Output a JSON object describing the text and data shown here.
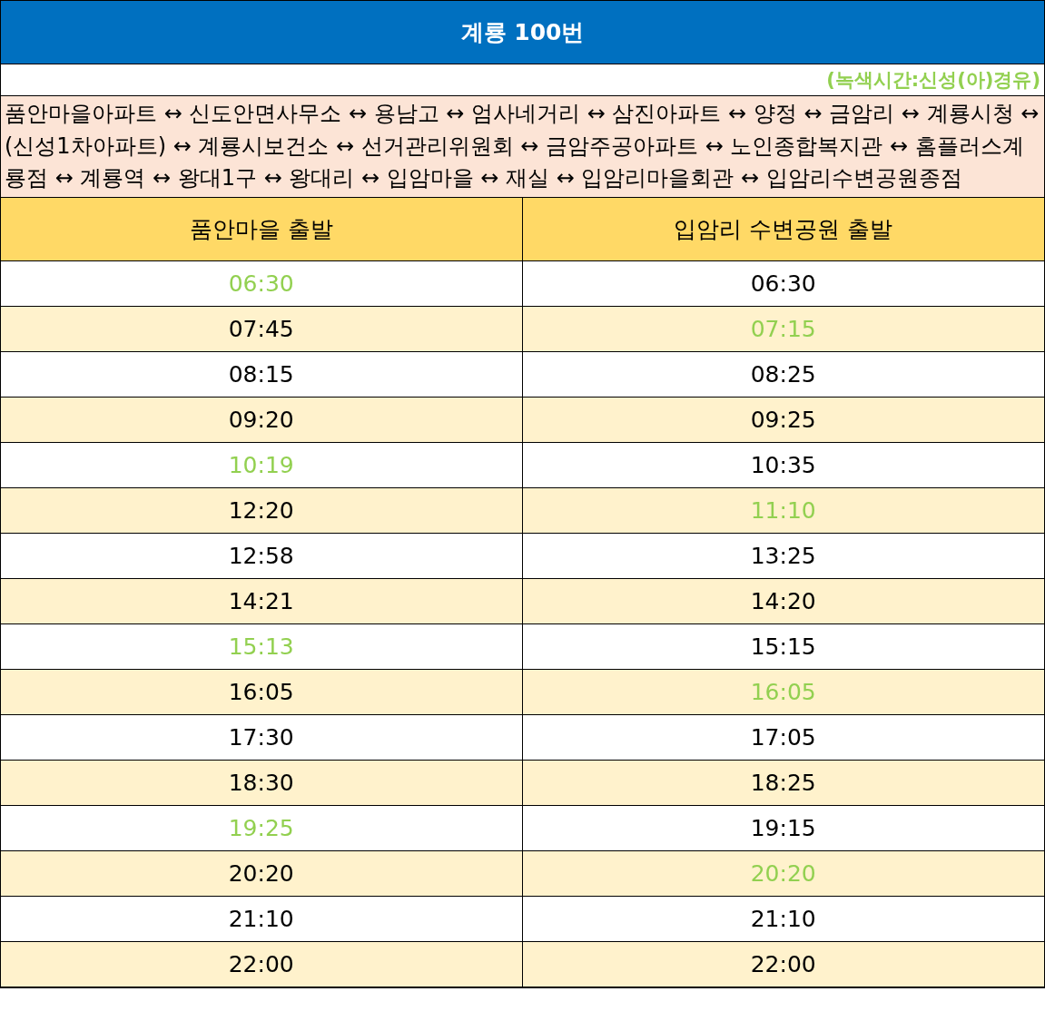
{
  "title": "계룡 100번",
  "note": "(녹색시간:신성(아)경유)",
  "route": "품안마을아파트 ↔ 신도안면사무소 ↔ 용남고 ↔ 엄사네거리 ↔ 삼진아파트 ↔ 양정 ↔ 금암리 ↔ 계룡시청 ↔ (신성1차아파트) ↔ 계룡시보건소 ↔ 선거관리위원회 ↔ 금암주공아파트 ↔ 노인종합복지관 ↔ 홈플러스계룡점 ↔ 계룡역 ↔ 왕대1구 ↔ 왕대리 ↔ 입암마을 ↔ 재실 ↔ 입암리마을회관 ↔ 입암리수변공원종점",
  "columns": [
    "품안마을 출발",
    "입암리 수변공원 출발"
  ],
  "rows": [
    {
      "cells": [
        {
          "time": "06:30",
          "highlighted": true
        },
        {
          "time": "06:30",
          "highlighted": false
        }
      ]
    },
    {
      "cells": [
        {
          "time": "07:45",
          "highlighted": false
        },
        {
          "time": "07:15",
          "highlighted": true
        }
      ]
    },
    {
      "cells": [
        {
          "time": "08:15",
          "highlighted": false
        },
        {
          "time": "08:25",
          "highlighted": false
        }
      ]
    },
    {
      "cells": [
        {
          "time": "09:20",
          "highlighted": false
        },
        {
          "time": "09:25",
          "highlighted": false
        }
      ]
    },
    {
      "cells": [
        {
          "time": "10:19",
          "highlighted": true
        },
        {
          "time": "10:35",
          "highlighted": false
        }
      ]
    },
    {
      "cells": [
        {
          "time": "12:20",
          "highlighted": false
        },
        {
          "time": "11:10",
          "highlighted": true
        }
      ]
    },
    {
      "cells": [
        {
          "time": "12:58",
          "highlighted": false
        },
        {
          "time": "13:25",
          "highlighted": false
        }
      ]
    },
    {
      "cells": [
        {
          "time": "14:21",
          "highlighted": false
        },
        {
          "time": "14:20",
          "highlighted": false
        }
      ]
    },
    {
      "cells": [
        {
          "time": "15:13",
          "highlighted": true
        },
        {
          "time": "15:15",
          "highlighted": false
        }
      ]
    },
    {
      "cells": [
        {
          "time": "16:05",
          "highlighted": false
        },
        {
          "time": "16:05",
          "highlighted": true
        }
      ]
    },
    {
      "cells": [
        {
          "time": "17:30",
          "highlighted": false
        },
        {
          "time": "17:05",
          "highlighted": false
        }
      ]
    },
    {
      "cells": [
        {
          "time": "18:30",
          "highlighted": false
        },
        {
          "time": "18:25",
          "highlighted": false
        }
      ]
    },
    {
      "cells": [
        {
          "time": "19:25",
          "highlighted": true
        },
        {
          "time": "19:15",
          "highlighted": false
        }
      ]
    },
    {
      "cells": [
        {
          "time": "20:20",
          "highlighted": false
        },
        {
          "time": "20:20",
          "highlighted": true
        }
      ]
    },
    {
      "cells": [
        {
          "time": "21:10",
          "highlighted": false
        },
        {
          "time": "21:10",
          "highlighted": false
        }
      ]
    },
    {
      "cells": [
        {
          "time": "22:00",
          "highlighted": false
        },
        {
          "time": "22:00",
          "highlighted": false
        }
      ]
    }
  ]
}
